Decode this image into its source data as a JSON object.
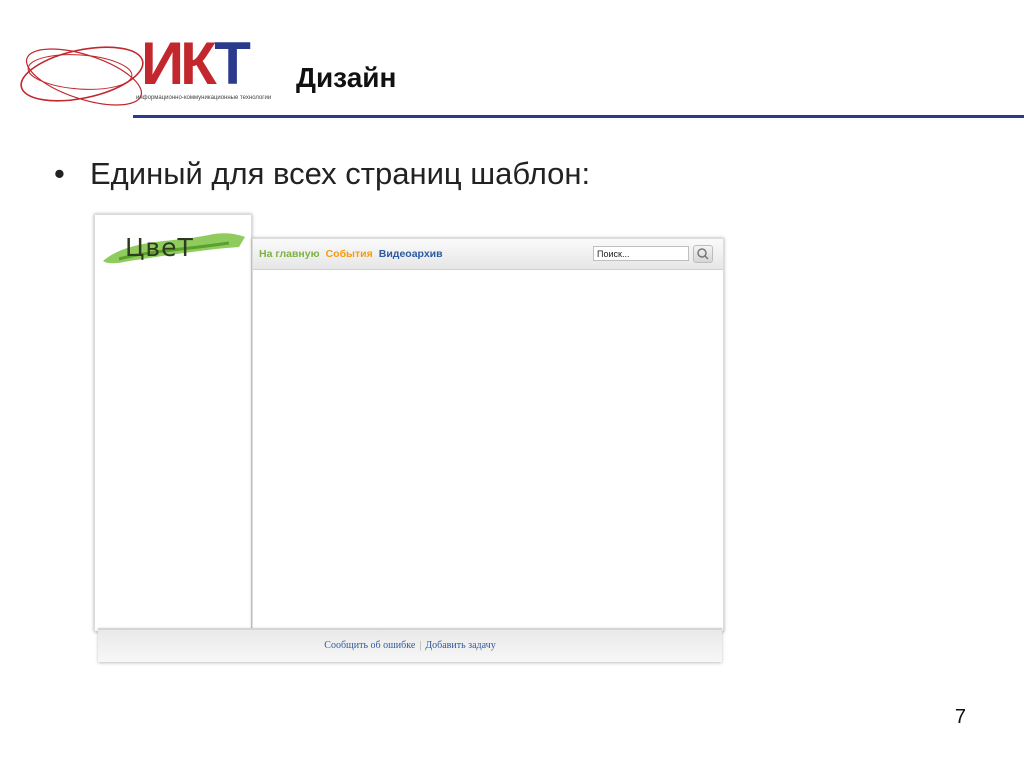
{
  "header": {
    "logo_text_part1": "ИК",
    "logo_text_part2": "Т",
    "logo_subtitle": "информационно-коммуникационные технологии",
    "title": "Дизайн"
  },
  "content": {
    "bullet_symbol": "•",
    "bullet_text": "Единый для всех страниц шаблон:"
  },
  "mockup": {
    "logo_text": "ЦвеТ",
    "nav": {
      "home": "На главную",
      "events": "События",
      "video": "Видеоархив"
    },
    "search_placeholder": "Поиск...",
    "footer": {
      "report": "Сообщить об ошибке",
      "separator": "|",
      "add_task": "Добавить задачу"
    }
  },
  "page_number": "7",
  "colors": {
    "brand_red": "#c1272d",
    "brand_blue": "#2b3a8c",
    "nav_green": "#7cb342",
    "nav_orange": "#f39c12",
    "nav_blue": "#2c5aa0"
  }
}
